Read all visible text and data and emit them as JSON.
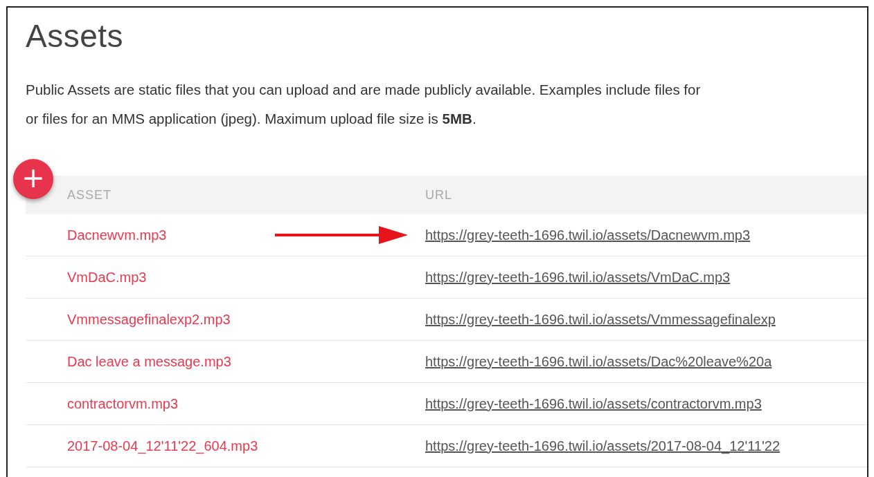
{
  "title": "Assets",
  "description": "Public Assets are static files that you can upload and are made publicly available. Examples include files for",
  "description_line_2": "or files for an MMS application (jpeg). Maximum upload file size is **5MB**.",
  "add_button": {
    "label": "+"
  },
  "table": {
    "columns": [
      "ASSET",
      "URL"
    ],
    "rows": [
      {
        "asset": "Dacnewvm.mp3",
        "url": "https://grey-teeth-1696.twil.io/assets/Dacnewvm.mp3",
        "pointed": true
      },
      {
        "asset": "VmDaC.mp3",
        "url": "https://grey-teeth-1696.twil.io/assets/VmDaC.mp3",
        "pointed": false
      },
      {
        "asset": "Vmmessagefinalexp2.mp3",
        "url": "https://grey-teeth-1696.twil.io/assets/Vmmessagefinalexp",
        "pointed": false
      },
      {
        "asset": "Dac leave a message.mp3",
        "url": "https://grey-teeth-1696.twil.io/assets/Dac%20leave%20a",
        "pointed": false
      },
      {
        "asset": "contractorvm.mp3",
        "url": "https://grey-teeth-1696.twil.io/assets/contractorvm.mp3",
        "pointed": false
      },
      {
        "asset": "2017-08-04_12'11'22_604.mp3",
        "url": "https://grey-teeth-1696.twil.io/assets/2017-08-04_12'11'22",
        "pointed": false
      }
    ]
  }
}
